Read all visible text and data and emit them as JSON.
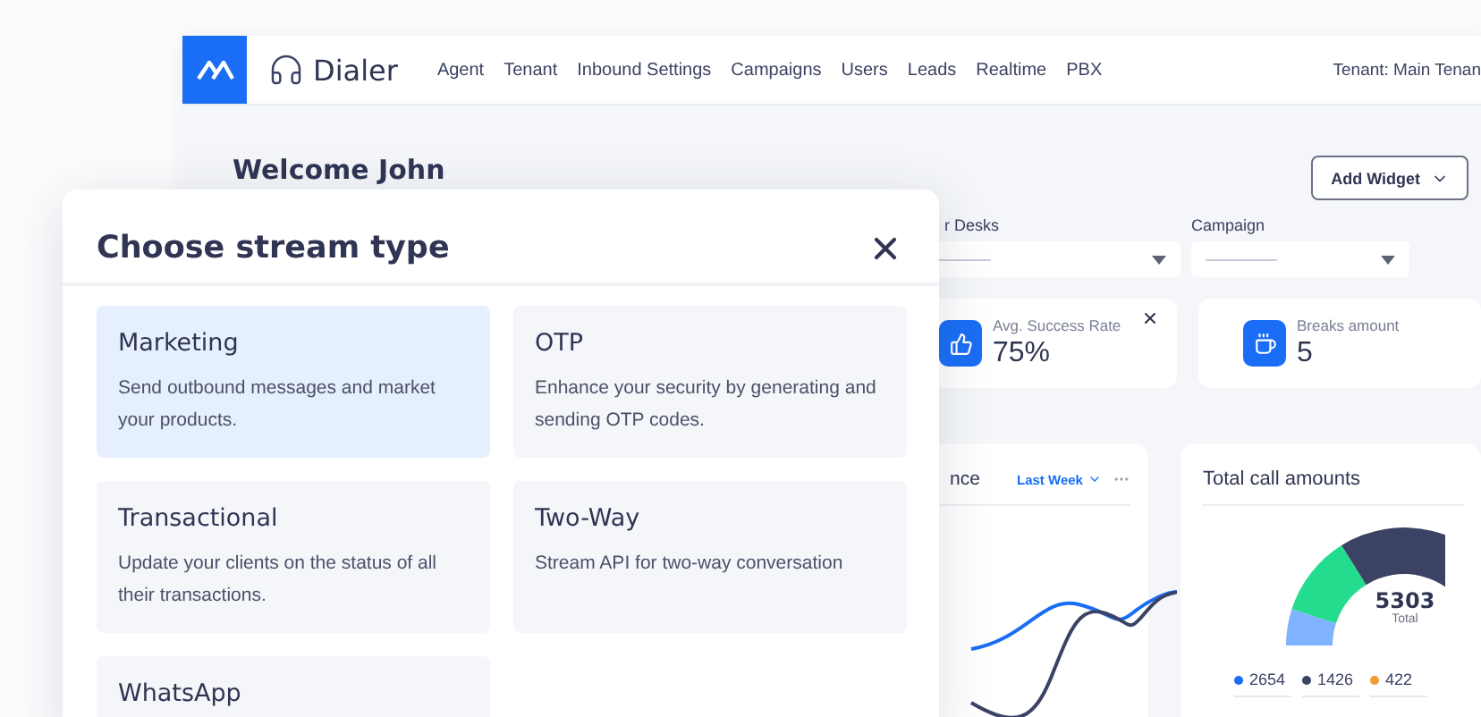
{
  "header": {
    "brand": "Dialer",
    "nav": [
      {
        "label": "Agent"
      },
      {
        "label": "Tenant"
      },
      {
        "label": "Inbound Settings"
      },
      {
        "label": "Campaigns"
      },
      {
        "label": "Users"
      },
      {
        "label": "Leads"
      },
      {
        "label": "Realtime"
      },
      {
        "label": "PBX"
      }
    ],
    "tenant": "Tenant: Main Tenan"
  },
  "dashboard": {
    "welcome": "Welcome John",
    "add_widget": "Add Widget",
    "filters": [
      {
        "label": "r Desks"
      },
      {
        "label": "Campaign"
      }
    ],
    "stats": [
      {
        "kind": "success",
        "label": "Avg. Success Rate",
        "value": "75%",
        "closable": true
      },
      {
        "kind": "breaks",
        "label": "Breaks amount",
        "value": "5",
        "closable": false
      }
    ],
    "performance": {
      "title": "nce",
      "period": "Last Week"
    },
    "totals": {
      "title": "Total call amounts",
      "total": "5303",
      "total_label": "Total",
      "legend": [
        {
          "value": "2654",
          "color": "#1a6ef5"
        },
        {
          "value": "1426",
          "color": "#3b4263"
        },
        {
          "value": "422",
          "color": "#f29a38"
        }
      ]
    }
  },
  "modal": {
    "title": "Choose stream type",
    "options": [
      {
        "title": "Marketing",
        "description": "Send outbound messages and market your products.",
        "selected": true
      },
      {
        "title": "OTP",
        "description": "Enhance your security by generating and sending OTP codes.",
        "selected": false
      },
      {
        "title": "Transactional",
        "description": "Update your clients on the status of all their transactions.",
        "selected": false
      },
      {
        "title": "Two-Way",
        "description": "Stream API for two-way conversation",
        "selected": false
      },
      {
        "title": "WhatsApp",
        "selected": false
      }
    ]
  }
}
